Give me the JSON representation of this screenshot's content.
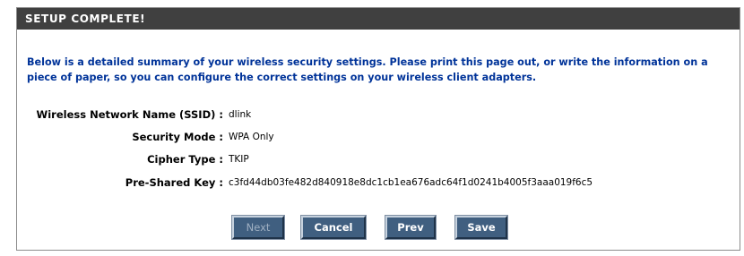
{
  "header": {
    "title": "SETUP COMPLETE!"
  },
  "intro": {
    "text": "Below is a detailed summary of your wireless security settings. Please print this page out, or write the information on a piece of paper, so you can configure the correct settings on your wireless client adapters."
  },
  "summary": {
    "ssid": {
      "label": "Wireless Network Name (SSID) :",
      "value": "dlink"
    },
    "security_mode": {
      "label": "Security Mode :",
      "value": "WPA Only"
    },
    "cipher_type": {
      "label": "Cipher Type :",
      "value": "TKIP"
    },
    "psk": {
      "label": "Pre-Shared Key :",
      "value": "c3fd44db03fe482d840918e8dc1cb1ea676adc64f1d0241b4005f3aaa019f6c5"
    }
  },
  "buttons": {
    "next": {
      "label": "Next",
      "enabled": false
    },
    "cancel": {
      "label": "Cancel",
      "enabled": true
    },
    "prev": {
      "label": "Prev",
      "enabled": true
    },
    "save": {
      "label": "Save",
      "enabled": true
    }
  },
  "colors": {
    "title_bar": "#404040",
    "intro_text": "#003399",
    "button_bg": "#405f80"
  }
}
